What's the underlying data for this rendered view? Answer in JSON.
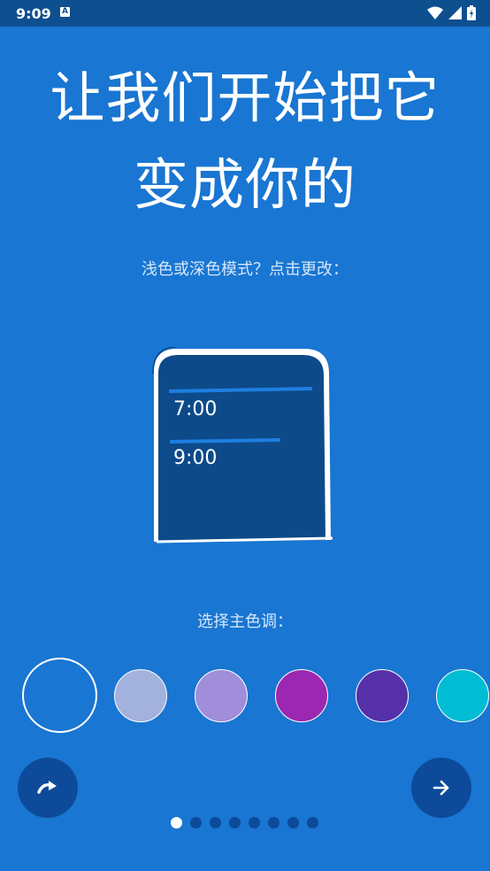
{
  "status_bar": {
    "time": "9:09",
    "notification_icon": "A",
    "icons": [
      "wifi-icon",
      "signal-icon",
      "battery-icon"
    ]
  },
  "headline": {
    "line1": "让我们开始把它",
    "line2": "变成你的"
  },
  "theme_prompt": "浅色或深色模式？点击更改：",
  "phone_preview": {
    "alarm1": "7:00",
    "alarm2": "9:00",
    "screen_color": "#0D4A8A"
  },
  "accent_prompt": "选择主色调：",
  "accent_colors": [
    {
      "name": "blue",
      "color": "#1976D2",
      "selected": true
    },
    {
      "name": "lavender",
      "color": "#A3B1DD",
      "selected": false
    },
    {
      "name": "light-purple",
      "color": "#A08EDB",
      "selected": false
    },
    {
      "name": "magenta",
      "color": "#9C27B0",
      "selected": false
    },
    {
      "name": "deep-purple",
      "color": "#5530A8",
      "selected": false
    },
    {
      "name": "cyan",
      "color": "#00BCD4",
      "selected": false
    }
  ],
  "navigation": {
    "skip_icon": "redo-arrow-icon",
    "next_icon": "arrow-right-icon",
    "page_count": 8,
    "current_page": 1
  }
}
